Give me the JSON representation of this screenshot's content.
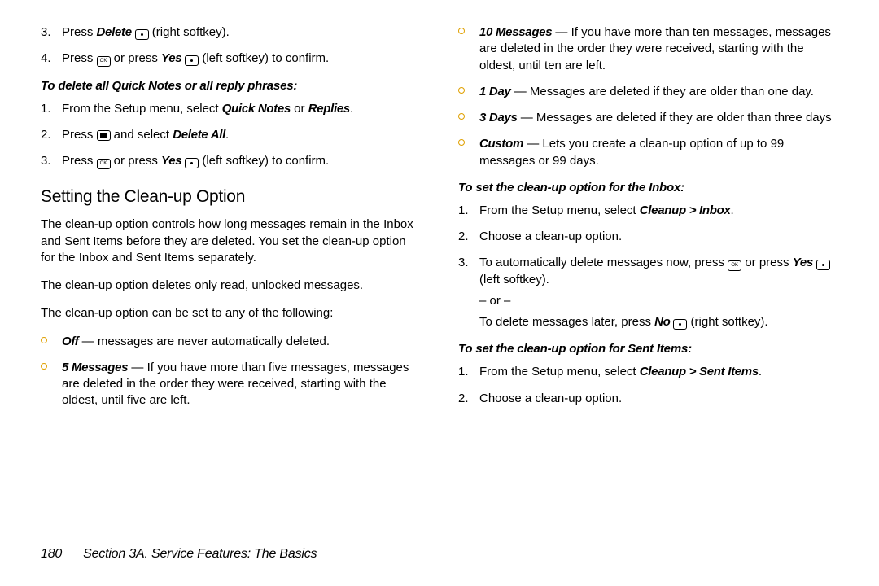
{
  "left": {
    "ol1": [
      {
        "n": "3.",
        "pre": "Press ",
        "bi": "Delete ",
        "key": "dot",
        "post": " (right softkey)."
      },
      {
        "n": "4.",
        "pre": "Press ",
        "key1": "ok",
        "mid": " or press ",
        "bi": "Yes ",
        "key2": "dot",
        "post": " (left softkey) to confirm."
      }
    ],
    "sub1": "To delete all Quick Notes or all reply phrases:",
    "ol2": [
      {
        "n": "1.",
        "pre": "From the Setup menu, select ",
        "bi": "Quick Notes",
        "mid": " or ",
        "bi2": "Replies",
        "post": "."
      },
      {
        "n": "2.",
        "pre": "Press ",
        "key1": "menu",
        "mid": " and select ",
        "bi": "Delete All",
        "post": "."
      },
      {
        "n": "3.",
        "pre": "Press ",
        "key1": "ok",
        "mid": " or press ",
        "bi": "Yes ",
        "key2": "dot",
        "post": " (left softkey) to confirm."
      }
    ],
    "h2": "Setting the Clean-up Option",
    "p1": "The clean-up option controls how long messages remain in the Inbox and Sent Items before they are deleted. You set the clean-up option for the Inbox and Sent Items separately.",
    "p2": "The clean-up option deletes only read, unlocked messages.",
    "p3": "The clean-up option can be set to any of the following:",
    "ul1": [
      {
        "bi": "Off",
        "post": " — messages are never automatically deleted."
      },
      {
        "bi": "5 Messages",
        "post": " — If you have more than five messages, messages are deleted in the order they were received, starting with the oldest, until five are left."
      }
    ]
  },
  "right": {
    "ul1": [
      {
        "bi": "10 Messages",
        "post": " — If you have more than ten messages, messages are deleted in the order they were received, starting with the oldest, until ten are left."
      },
      {
        "bi": "1 Day",
        "post": " — Messages are deleted if they are older than one day."
      },
      {
        "bi": "3 Days",
        "post": " — Messages are deleted if they are older than three days"
      },
      {
        "bi": "Custom",
        "post": " — Lets you create a clean-up option of up to 99 messages or 99 days."
      }
    ],
    "sub1": "To set the clean-up option for the Inbox:",
    "ol1": [
      {
        "n": "1.",
        "pre": "From the Setup menu, select ",
        "bi": "Cleanup > Inbox",
        "post": "."
      },
      {
        "n": "2.",
        "pre": "Choose a clean-up option.",
        "post": ""
      },
      {
        "n": "3.",
        "pre": "To automatically delete messages now, press ",
        "key1": "ok",
        "mid": " or press ",
        "bi": "Yes ",
        "key2": "dot",
        "post": " (left softkey).",
        "sub": [
          {
            "t": "– or –"
          },
          {
            "pre": "To delete messages later, press ",
            "bi": "No ",
            "key": "dot",
            "post": " (right softkey)."
          }
        ]
      }
    ],
    "sub2": "To set the clean-up option for Sent Items:",
    "ol2": [
      {
        "n": "1.",
        "pre": "From the Setup menu, select ",
        "bi": "Cleanup > Sent Items",
        "post": "."
      },
      {
        "n": "2.",
        "pre": "Choose a clean-up option.",
        "post": ""
      }
    ]
  },
  "footer": {
    "pn": "180",
    "sec": "Section 3A. Service Features: The Basics"
  }
}
